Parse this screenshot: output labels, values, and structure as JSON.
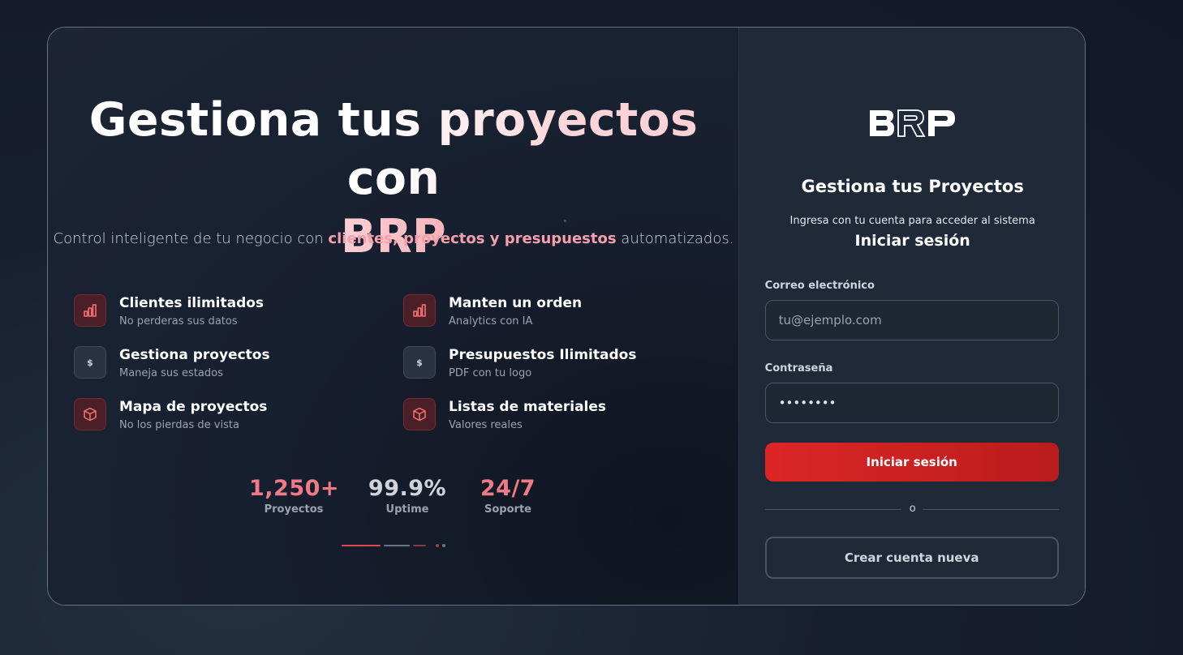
{
  "hero": {
    "title_line1": "Gestiona tus proyectos con",
    "title_brand": "BRP",
    "subtitle_before": "Control inteligente de tu negocio con ",
    "subtitle_highlight": "clientes, proyectos y presupuestos",
    "subtitle_after": " automatizados."
  },
  "features": [
    {
      "title": "Clientes ilimitados",
      "subtitle": "No perderas sus datos",
      "icon": "bar-chart-icon"
    },
    {
      "title": "Manten un orden",
      "subtitle": "Analytics con IA",
      "icon": "bar-chart-icon"
    },
    {
      "title": "Gestiona proyectos",
      "subtitle": "Maneja sus estados",
      "icon": "dollar-icon",
      "icon_text": "$"
    },
    {
      "title": "Presupuestos Ilimitados",
      "subtitle": "PDF con tu logo",
      "icon": "dollar-icon",
      "icon_text": "$"
    },
    {
      "title": "Mapa de proyectos",
      "subtitle": "No los pierdas de vista",
      "icon": "box-icon"
    },
    {
      "title": "Listas de materiales",
      "subtitle": "Valores reales",
      "icon": "box-icon"
    }
  ],
  "stats": [
    {
      "value": "1,250+",
      "label": "Proyectos",
      "color": "#f07a85"
    },
    {
      "value": "99.9%",
      "label": "Uptime",
      "color": "#d1d5db"
    },
    {
      "value": "24/7",
      "label": "Soporte",
      "color": "#f07a85"
    }
  ],
  "login": {
    "logo_text": "BRP",
    "title": "Gestiona tus Proyectos",
    "subtitle": "Ingresa con tu cuenta para acceder al sistema",
    "heading": "Iniciar sesión",
    "email_label": "Correo electrónico",
    "email_placeholder": "tu@ejemplo.com",
    "password_label": "Contraseña",
    "password_value": "••••••••",
    "submit_label": "Iniciar sesión",
    "divider_text": "o",
    "create_account_label": "Crear cuenta nueva"
  },
  "colors": {
    "accent": "#dc2626",
    "highlight": "#f49fab",
    "background": "#111827",
    "panel": "#1f2937"
  }
}
